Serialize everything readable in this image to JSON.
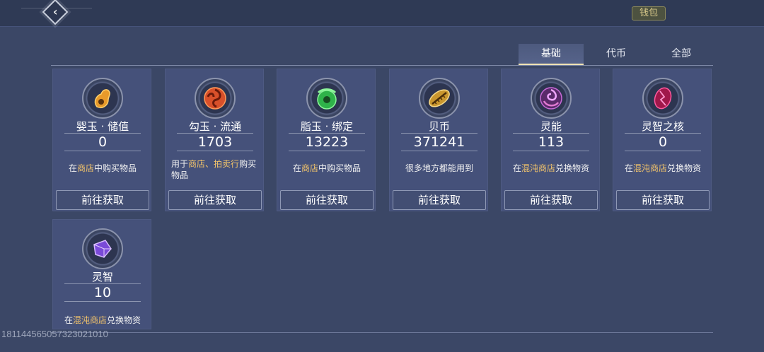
{
  "topbar": {
    "wallet_label": "钱包"
  },
  "tabs": [
    {
      "label": "基础",
      "active": true
    },
    {
      "label": "代币",
      "active": false
    },
    {
      "label": "全部",
      "active": false
    }
  ],
  "cards": [
    {
      "name": "婴玉 · 储值",
      "amount": "0",
      "desc_pre": "在",
      "desc_hl1": "商店",
      "desc_mid": "中购买物品",
      "desc_hl2": "",
      "desc_post": "",
      "button": "前往获取",
      "icon": "amber-jade-icon"
    },
    {
      "name": "勾玉 · 流通",
      "amount": "1703",
      "desc_pre": "用于",
      "desc_hl1": "商店",
      "desc_mid": "、",
      "desc_hl2": "拍卖行",
      "desc_post": "购买物品",
      "button": "前往获取",
      "icon": "red-swirl-jade-icon"
    },
    {
      "name": "脂玉 · 绑定",
      "amount": "13223",
      "desc_pre": "在",
      "desc_hl1": "商店",
      "desc_mid": "中购买物品",
      "desc_hl2": "",
      "desc_post": "",
      "button": "前往获取",
      "icon": "green-jade-icon"
    },
    {
      "name": "贝币",
      "amount": "371241",
      "desc_pre": "很多地方都能用到",
      "desc_hl1": "",
      "desc_mid": "",
      "desc_hl2": "",
      "desc_post": "",
      "button": "前往获取",
      "icon": "shell-coin-icon"
    },
    {
      "name": "灵能",
      "amount": "113",
      "desc_pre": "在",
      "desc_hl1": "混沌商店",
      "desc_mid": "兑换物资",
      "desc_hl2": "",
      "desc_post": "",
      "button": "前往获取",
      "icon": "purple-swirl-orb-icon"
    },
    {
      "name": "灵智之核",
      "amount": "0",
      "desc_pre": "在",
      "desc_hl1": "混沌商店",
      "desc_mid": "兑换物资",
      "desc_hl2": "",
      "desc_post": "",
      "button": "前往获取",
      "icon": "crimson-core-icon"
    },
    {
      "name": "灵智",
      "amount": "10",
      "desc_pre": "在",
      "desc_hl1": "混沌商店",
      "desc_mid": "兑换物资",
      "desc_hl2": "",
      "desc_post": "",
      "button": "",
      "icon": "violet-crystal-icon"
    }
  ],
  "footer": {
    "uid": "1811445650573230​21010"
  },
  "colors": {
    "background": "#3b4766",
    "card": "#45517a",
    "highlight": "#f3c46a",
    "tab_underline": "#f1e4b4"
  }
}
